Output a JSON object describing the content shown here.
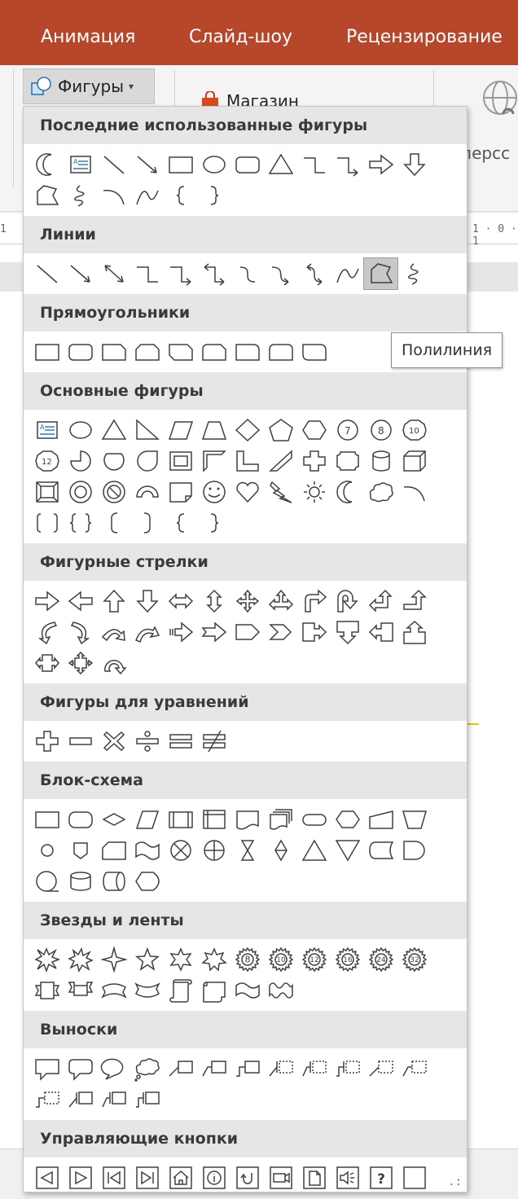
{
  "tabs": [
    "Анимация",
    "Слайд-шоу",
    "Рецензирование"
  ],
  "ribbon": {
    "shapes_button": "Фигуры",
    "store_button": "Магазин",
    "cut_label": "персс"
  },
  "ruler_text": [
    "1",
    "1 · 0 · 1"
  ],
  "tooltip": "Полилиния",
  "colors": {
    "accent": "#b7472a",
    "header_bg": "#e6e6e6",
    "shape_stroke": "#404040",
    "highlight": "#c8c8c8"
  },
  "sections": [
    {
      "title": "Последние использованные фигуры",
      "rows": [
        [
          "moon-icon",
          "text-box-icon",
          "line-icon",
          "arrow-line-icon",
          "rectangle-icon",
          "oval-icon",
          "rounded-rectangle-icon",
          "triangle-icon",
          "elbow-connector-icon",
          "elbow-arrow-connector-icon",
          "right-arrow-icon",
          "down-arrow-icon"
        ],
        [
          "freeform-icon",
          "scribble-icon",
          "arc-icon",
          "curve-icon",
          "left-brace-icon",
          "right-brace-icon"
        ]
      ]
    },
    {
      "title": "Линии",
      "rows": [
        [
          "line-icon",
          "arrow-line-icon",
          "double-arrow-line-icon",
          "elbow-connector-icon",
          "elbow-arrow-connector-icon",
          "elbow-double-arrow-icon",
          "curved-connector-icon",
          "curved-arrow-connector-icon",
          "curved-double-arrow-icon",
          "curve-icon",
          "freeform-icon",
          "scribble-icon"
        ]
      ],
      "highlighted": 10
    },
    {
      "title": "Прямоугольники",
      "rows": [
        [
          "rectangle-icon",
          "rounded-rectangle-icon",
          "snip-single-corner-icon",
          "snip-same-side-icon",
          "snip-diagonal-icon",
          "snip-round-icon",
          "round-single-corner-icon",
          "round-same-side-icon",
          "round-diagonal-icon"
        ]
      ]
    },
    {
      "title": "Основные фигуры",
      "rows": [
        [
          "text-box-icon",
          "oval-icon",
          "triangle-icon",
          "right-triangle-icon",
          "parallelogram-icon",
          "trapezoid-icon",
          "diamond-icon",
          "pentagon-icon",
          "hexagon-icon",
          "heptagon-icon",
          "octagon-icon",
          "decagon-icon"
        ],
        [
          "dodecagon-icon",
          "pie-icon",
          "chord-icon",
          "teardrop-icon",
          "frame-icon",
          "half-frame-icon",
          "l-shape-icon",
          "diagonal-stripe-icon",
          "cross-icon",
          "plaque-icon",
          "can-icon",
          "cube-icon"
        ],
        [
          "bevel-icon",
          "donut-icon",
          "no-symbol-icon",
          "block-arc-icon",
          "folded-corner-icon",
          "smiley-face-icon",
          "heart-icon",
          "lightning-bolt-icon",
          "sun-icon",
          "moon-icon",
          "cloud-icon",
          "arc-icon"
        ],
        [
          "double-bracket-icon",
          "double-brace-icon",
          "left-bracket-icon",
          "right-bracket-icon",
          "left-brace-icon",
          "right-brace-icon"
        ]
      ]
    },
    {
      "title": "Фигурные стрелки",
      "rows": [
        [
          "right-arrow-icon",
          "left-arrow-icon",
          "up-arrow-icon",
          "down-arrow-icon",
          "left-right-arrow-icon",
          "up-down-arrow-icon",
          "quad-arrow-icon",
          "left-right-up-arrow-icon",
          "bent-arrow-icon",
          "u-turn-arrow-icon",
          "left-up-arrow-icon",
          "bent-up-arrow-icon"
        ],
        [
          "curved-right-arrow-icon",
          "curved-left-arrow-icon",
          "curved-up-arrow-icon",
          "curved-down-arrow-icon",
          "striped-right-arrow-icon",
          "notched-right-arrow-icon",
          "pentagon-arrow-icon",
          "chevron-icon",
          "right-arrow-callout-icon",
          "down-arrow-callout-icon",
          "left-arrow-callout-icon",
          "up-arrow-callout-icon"
        ],
        [
          "left-right-arrow-callout-icon",
          "quad-arrow-callout-icon",
          "circular-arrow-icon"
        ]
      ]
    },
    {
      "title": "Фигуры для уравнений",
      "rows": [
        [
          "plus-icon",
          "minus-icon",
          "multiply-icon",
          "division-icon",
          "equal-icon",
          "not-equal-icon"
        ]
      ]
    },
    {
      "title": "Блок-схема",
      "rows": [
        [
          "flowchart-process-icon",
          "flowchart-alternate-process-icon",
          "flowchart-decision-icon",
          "flowchart-data-icon",
          "flowchart-predefined-process-icon",
          "flowchart-internal-storage-icon",
          "flowchart-document-icon",
          "flowchart-multidocument-icon",
          "flowchart-terminator-icon",
          "flowchart-preparation-icon",
          "flowchart-manual-input-icon",
          "flowchart-manual-operation-icon"
        ],
        [
          "flowchart-connector-icon",
          "flowchart-offpage-connector-icon",
          "flowchart-card-icon",
          "flowchart-punched-tape-icon",
          "flowchart-summing-junction-icon",
          "flowchart-or-icon",
          "flowchart-collate-icon",
          "flowchart-sort-icon",
          "flowchart-extract-icon",
          "flowchart-merge-icon",
          "flowchart-stored-data-icon",
          "flowchart-delay-icon"
        ],
        [
          "flowchart-sequential-access-icon",
          "flowchart-magnetic-disk-icon",
          "flowchart-direct-access-icon",
          "flowchart-display-icon"
        ]
      ]
    },
    {
      "title": "Звезды и ленты",
      "rows": [
        [
          "explosion-1-icon",
          "explosion-2-icon",
          "star-4-icon",
          "star-5-icon",
          "star-6-icon",
          "star-7-icon",
          "star-8-icon",
          "star-10-icon",
          "star-12-icon",
          "star-16-icon",
          "star-24-icon",
          "star-32-icon"
        ],
        [
          "ribbon-up-icon",
          "ribbon-down-icon",
          "curved-ribbon-up-icon",
          "curved-ribbon-down-icon",
          "vertical-scroll-icon",
          "horizontal-scroll-icon",
          "wave-icon",
          "double-wave-icon"
        ]
      ]
    },
    {
      "title": "Выноски",
      "rows": [
        [
          "rectangular-callout-icon",
          "rounded-callout-icon",
          "oval-callout-icon",
          "cloud-callout-icon",
          "line-callout-1-icon",
          "line-callout-2-icon",
          "line-callout-3-icon",
          "line-callout-1-accent-icon",
          "line-callout-2-accent-icon",
          "line-callout-3-accent-icon",
          "line-callout-1-noborder-icon",
          "line-callout-2-noborder-icon"
        ],
        [
          "line-callout-3-noborder-icon",
          "line-callout-1-border-accent-icon",
          "line-callout-2-border-accent-icon",
          "line-callout-3-border-accent-icon"
        ]
      ]
    },
    {
      "title": "Управляющие кнопки",
      "rows": [
        [
          "action-back-icon",
          "action-forward-icon",
          "action-beginning-icon",
          "action-end-icon",
          "action-home-icon",
          "action-information-icon",
          "action-return-icon",
          "action-movie-icon",
          "action-document-icon",
          "action-sound-icon",
          "action-help-icon",
          "action-custom-icon"
        ]
      ]
    }
  ]
}
